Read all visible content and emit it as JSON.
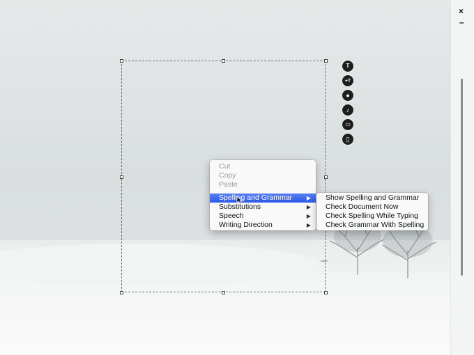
{
  "window": {
    "close_glyph": "×",
    "minimize_glyph": "–"
  },
  "toolbar": {
    "tools": [
      {
        "name": "text-tool",
        "glyph": "T",
        "icon": "text-icon"
      },
      {
        "name": "resize-text-tool",
        "glyph": "+T",
        "icon": "text-size-icon"
      },
      {
        "name": "record-tool",
        "glyph": "●",
        "icon": "circle-icon"
      },
      {
        "name": "music-tool",
        "glyph": "♪",
        "icon": "music-note-icon"
      },
      {
        "name": "video-tool",
        "glyph": "▭",
        "icon": "film-icon"
      },
      {
        "name": "document-tool",
        "glyph": "▯",
        "icon": "document-icon"
      }
    ]
  },
  "context_menu": {
    "cut": "Cut",
    "copy": "Copy",
    "paste": "Paste",
    "spelling_and_grammar": "Spelling and Grammar",
    "substitutions": "Substitutions",
    "speech": "Speech",
    "writing_direction": "Writing Direction",
    "submenu_arrow": "▶"
  },
  "submenu": {
    "show_spelling_and_grammar": "Show Spelling and Grammar",
    "check_document_now": "Check Document Now",
    "check_spelling_while_typing": "Check Spelling While Typing",
    "check_grammar_with_spelling": "Check Grammar With Spelling"
  },
  "colors": {
    "highlight": "#2b58e8",
    "selection_border": "#6c7272"
  }
}
